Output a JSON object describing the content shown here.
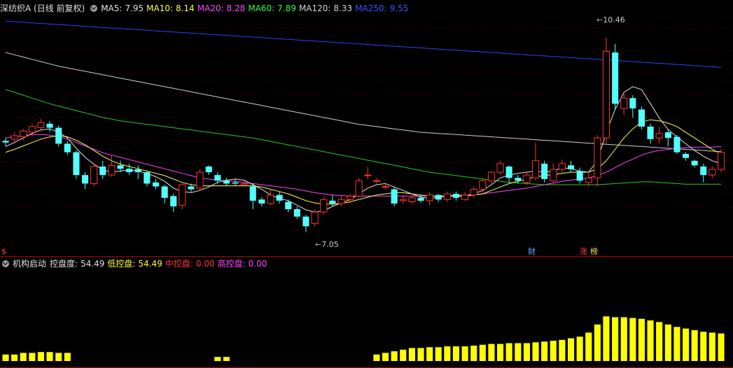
{
  "main": {
    "title": "深纺织A (日线 前复权)",
    "ma": [
      {
        "label": "MA5:",
        "value": "7.95",
        "color": "#e0e0e0"
      },
      {
        "label": "MA10:",
        "value": "8.14",
        "color": "#ffff55"
      },
      {
        "label": "MA20:",
        "value": "8.28",
        "color": "#ff44ff"
      },
      {
        "label": "MA60:",
        "value": "7.89",
        "color": "#33ff33"
      },
      {
        "label": "MA120:",
        "value": "8.33",
        "color": "#d0d0d0"
      },
      {
        "label": "MA250:",
        "value": "9.55",
        "color": "#3355ff"
      }
    ],
    "high_label": "10.46",
    "low_label": "7.05",
    "tags": {
      "left": "$",
      "cai": "财",
      "zhang": "涨",
      "bang": "榜"
    }
  },
  "sub": {
    "title": "机构启动",
    "items": [
      {
        "label": "控盘度:",
        "value": "54.49",
        "color": "#e0e0e0"
      },
      {
        "label": "低控盘:",
        "value": "54.49",
        "color": "#ffff33"
      },
      {
        "label": "中控盘:",
        "value": "0.00",
        "color": "#ff3333"
      },
      {
        "label": "高控盘:",
        "value": "0.00",
        "color": "#ff44ff"
      }
    ]
  },
  "chart_data": {
    "type": "candlestick",
    "y_range": [
      6.8,
      10.9
    ],
    "candles": [
      [
        8.65,
        8.62,
        8.7,
        8.55
      ],
      [
        8.68,
        8.74,
        8.8,
        8.62
      ],
      [
        8.72,
        8.82,
        8.86,
        8.66
      ],
      [
        8.8,
        8.9,
        8.94,
        8.74
      ],
      [
        8.88,
        8.97,
        9.03,
        8.82
      ],
      [
        8.95,
        8.88,
        9.0,
        8.8
      ],
      [
        8.88,
        8.6,
        8.92,
        8.55
      ],
      [
        8.6,
        8.45,
        8.65,
        8.4
      ],
      [
        8.45,
        8.05,
        8.48,
        7.98
      ],
      [
        8.05,
        7.9,
        8.1,
        7.8
      ],
      [
        7.9,
        8.2,
        8.25,
        7.85
      ],
      [
        8.2,
        8.05,
        8.3,
        7.98
      ],
      [
        8.05,
        8.22,
        8.4,
        8.02
      ],
      [
        8.22,
        8.16,
        8.3,
        8.1
      ],
      [
        8.16,
        8.1,
        8.25,
        8.05
      ],
      [
        8.15,
        8.1,
        8.22,
        7.98
      ],
      [
        8.1,
        7.9,
        8.12,
        7.85
      ],
      [
        7.92,
        7.85,
        7.98,
        7.8
      ],
      [
        7.85,
        7.65,
        7.88,
        7.55
      ],
      [
        7.68,
        7.5,
        7.72,
        7.4
      ],
      [
        7.52,
        7.88,
        7.92,
        7.45
      ],
      [
        7.85,
        7.8,
        7.9,
        7.75
      ],
      [
        7.82,
        8.1,
        8.15,
        7.78
      ],
      [
        8.2,
        8.1,
        8.22,
        8.05
      ],
      [
        8.05,
        7.95,
        8.1,
        7.9
      ],
      [
        7.95,
        7.9,
        8.0,
        7.86
      ],
      [
        7.92,
        7.9,
        7.98,
        7.86
      ],
      [
        7.88,
        7.9,
        7.95,
        7.84
      ],
      [
        7.85,
        7.6,
        7.9,
        7.45
      ],
      [
        7.62,
        7.55,
        7.66,
        7.5
      ],
      [
        7.55,
        7.7,
        7.8,
        7.52
      ],
      [
        7.7,
        7.6,
        7.75,
        7.55
      ],
      [
        7.58,
        7.45,
        7.62,
        7.4
      ],
      [
        7.45,
        7.32,
        7.5,
        7.28
      ],
      [
        7.32,
        7.15,
        7.35,
        7.05
      ],
      [
        7.2,
        7.4,
        7.45,
        7.15
      ],
      [
        7.4,
        7.62,
        7.66,
        7.35
      ],
      [
        7.6,
        7.55,
        7.7,
        7.5
      ],
      [
        7.55,
        7.62,
        7.7,
        7.5
      ],
      [
        7.62,
        7.68,
        7.72,
        7.55
      ],
      [
        7.68,
        7.95,
        8.0,
        7.65
      ],
      [
        8.05,
        8.05,
        8.2,
        7.98
      ],
      [
        7.95,
        7.95,
        8.0,
        7.9
      ],
      [
        7.85,
        7.85,
        7.9,
        7.8
      ],
      [
        7.8,
        7.55,
        7.85,
        7.5
      ],
      [
        7.6,
        7.62,
        7.7,
        7.55
      ],
      [
        7.58,
        7.65,
        7.72,
        7.55
      ],
      [
        7.65,
        7.6,
        7.7,
        7.56
      ],
      [
        7.6,
        7.7,
        7.75,
        7.52
      ],
      [
        7.7,
        7.62,
        7.72,
        7.58
      ],
      [
        7.62,
        7.72,
        7.76,
        7.58
      ],
      [
        7.72,
        7.65,
        7.76,
        7.6
      ],
      [
        7.62,
        7.7,
        7.75,
        7.6
      ],
      [
        7.7,
        7.8,
        7.85,
        7.65
      ],
      [
        7.8,
        7.95,
        8.0,
        7.75
      ],
      [
        7.95,
        8.1,
        8.12,
        7.9
      ],
      [
        8.1,
        8.25,
        8.3,
        8.05
      ],
      [
        8.2,
        8.0,
        8.22,
        7.92
      ],
      [
        8.0,
        7.95,
        8.05,
        7.9
      ],
      [
        7.92,
        8.05,
        8.1,
        7.88
      ],
      [
        8.0,
        8.3,
        8.62,
        7.95
      ],
      [
        8.25,
        7.98,
        8.3,
        7.92
      ],
      [
        7.95,
        8.15,
        8.25,
        7.92
      ],
      [
        8.15,
        8.25,
        8.32,
        8.1
      ],
      [
        8.22,
        8.15,
        8.3,
        8.1
      ],
      [
        8.12,
        7.95,
        8.18,
        7.9
      ],
      [
        7.92,
        8.0,
        8.1,
        7.85
      ],
      [
        8.0,
        8.7,
        8.75,
        7.85
      ],
      [
        8.7,
        10.22,
        10.46,
        8.6
      ],
      [
        10.2,
        9.3,
        10.35,
        9.2
      ],
      [
        9.22,
        9.4,
        9.5,
        9.1
      ],
      [
        9.4,
        9.22,
        9.45,
        9.05
      ],
      [
        9.2,
        8.9,
        9.25,
        8.85
      ],
      [
        8.9,
        8.68,
        8.95,
        8.6
      ],
      [
        8.7,
        8.78,
        8.9,
        8.6
      ],
      [
        8.8,
        8.7,
        8.85,
        8.55
      ],
      [
        8.72,
        8.45,
        8.75,
        8.42
      ],
      [
        8.42,
        8.35,
        8.45,
        8.3
      ],
      [
        8.3,
        8.22,
        8.32,
        8.18
      ],
      [
        8.2,
        8.05,
        8.25,
        7.92
      ],
      [
        8.05,
        8.15,
        8.2,
        8.0
      ],
      [
        8.15,
        8.45,
        8.5,
        8.1
      ]
    ],
    "ma5": [
      8.55,
      8.62,
      8.7,
      8.78,
      8.84,
      8.86,
      8.8,
      8.7,
      8.52,
      8.36,
      8.24,
      8.14,
      8.1,
      8.12,
      8.14,
      8.12,
      8.08,
      8.02,
      7.94,
      7.82,
      7.76,
      7.74,
      7.78,
      7.84,
      7.92,
      7.96,
      7.98,
      7.96,
      7.88,
      7.8,
      7.7,
      7.64,
      7.6,
      7.52,
      7.44,
      7.4,
      7.42,
      7.5,
      7.56,
      7.62,
      7.72,
      7.82,
      7.88,
      7.9,
      7.84,
      7.78,
      7.72,
      7.66,
      7.64,
      7.66,
      7.68,
      7.7,
      7.68,
      7.72,
      7.78,
      7.88,
      8.0,
      8.05,
      8.08,
      8.1,
      8.12,
      8.1,
      8.12,
      8.18,
      8.16,
      8.12,
      8.1,
      8.3,
      8.8,
      9.2,
      9.5,
      9.6,
      9.55,
      9.3,
      9.05,
      8.85,
      8.72,
      8.6,
      8.48,
      8.38,
      8.3,
      8.25
    ],
    "ma10": [
      8.45,
      8.5,
      8.56,
      8.62,
      8.68,
      8.72,
      8.74,
      8.72,
      8.66,
      8.58,
      8.48,
      8.38,
      8.3,
      8.24,
      8.2,
      8.16,
      8.12,
      8.08,
      8.04,
      7.98,
      7.92,
      7.88,
      7.86,
      7.86,
      7.86,
      7.86,
      7.86,
      7.86,
      7.86,
      7.84,
      7.8,
      7.76,
      7.72,
      7.66,
      7.6,
      7.56,
      7.54,
      7.54,
      7.55,
      7.58,
      7.62,
      7.66,
      7.7,
      7.72,
      7.74,
      7.74,
      7.72,
      7.7,
      7.68,
      7.68,
      7.68,
      7.68,
      7.68,
      7.7,
      7.72,
      7.78,
      7.84,
      7.9,
      7.94,
      7.98,
      8.02,
      8.04,
      8.06,
      8.08,
      8.1,
      8.1,
      8.1,
      8.16,
      8.3,
      8.5,
      8.7,
      8.86,
      8.98,
      9.02,
      9.0,
      8.96,
      8.9,
      8.8,
      8.7,
      8.6,
      8.5,
      8.42
    ],
    "ma20": [
      8.7,
      8.72,
      8.74,
      8.76,
      8.76,
      8.75,
      8.72,
      8.68,
      8.62,
      8.56,
      8.5,
      8.44,
      8.4,
      8.36,
      8.32,
      8.28,
      8.24,
      8.2,
      8.16,
      8.12,
      8.08,
      8.04,
      8.0,
      7.98,
      7.96,
      7.95,
      7.94,
      7.92,
      7.9,
      7.88,
      7.86,
      7.84,
      7.82,
      7.8,
      7.77,
      7.74,
      7.72,
      7.7,
      7.69,
      7.68,
      7.68,
      7.68,
      7.68,
      7.68,
      7.68,
      7.68,
      7.68,
      7.68,
      7.68,
      7.68,
      7.68,
      7.69,
      7.7,
      7.71,
      7.72,
      7.74,
      7.76,
      7.78,
      7.8,
      7.82,
      7.85,
      7.88,
      7.91,
      7.94,
      7.96,
      7.98,
      8.0,
      8.04,
      8.1,
      8.18,
      8.26,
      8.33,
      8.4,
      8.45,
      8.48,
      8.5,
      8.52,
      8.53,
      8.54,
      8.54,
      8.54,
      8.55
    ],
    "ma60": [
      9.55,
      9.5,
      9.45,
      9.4,
      9.35,
      9.3,
      9.26,
      9.22,
      9.18,
      9.14,
      9.1,
      9.06,
      9.03,
      9.0,
      8.98,
      8.96,
      8.94,
      8.92,
      8.9,
      8.88,
      8.86,
      8.84,
      8.82,
      8.8,
      8.78,
      8.76,
      8.74,
      8.72,
      8.7,
      8.67,
      8.64,
      8.61,
      8.58,
      8.55,
      8.52,
      8.49,
      8.46,
      8.43,
      8.4,
      8.37,
      8.34,
      8.31,
      8.28,
      8.25,
      8.22,
      8.19,
      8.16,
      8.13,
      8.1,
      8.08,
      8.06,
      8.04,
      8.02,
      8.0,
      7.98,
      7.96,
      7.94,
      7.92,
      7.91,
      7.9,
      7.89,
      7.88,
      7.88,
      7.88,
      7.88,
      7.88,
      7.88,
      7.88,
      7.89,
      7.9,
      7.91,
      7.92,
      7.93,
      7.93,
      7.92,
      7.91,
      7.9,
      7.89,
      7.89,
      7.89,
      7.89,
      7.89
    ],
    "ma120": [
      10.2,
      10.16,
      10.12,
      10.08,
      10.04,
      10.0,
      9.96,
      9.93,
      9.9,
      9.87,
      9.84,
      9.81,
      9.78,
      9.75,
      9.72,
      9.69,
      9.66,
      9.63,
      9.6,
      9.57,
      9.54,
      9.51,
      9.48,
      9.45,
      9.42,
      9.39,
      9.36,
      9.33,
      9.3,
      9.27,
      9.24,
      9.21,
      9.18,
      9.15,
      9.12,
      9.09,
      9.06,
      9.03,
      9.0,
      8.97,
      8.94,
      8.92,
      8.9,
      8.88,
      8.86,
      8.84,
      8.82,
      8.8,
      8.79,
      8.78,
      8.77,
      8.76,
      8.75,
      8.74,
      8.73,
      8.72,
      8.71,
      8.7,
      8.69,
      8.68,
      8.67,
      8.66,
      8.65,
      8.64,
      8.63,
      8.62,
      8.61,
      8.6,
      8.59,
      8.58,
      8.57,
      8.56,
      8.55,
      8.54,
      8.53,
      8.52,
      8.51,
      8.5,
      8.49,
      8.48,
      8.47,
      8.46
    ],
    "ma250": [
      10.75,
      10.74,
      10.73,
      10.72,
      10.71,
      10.7,
      10.69,
      10.68,
      10.67,
      10.66,
      10.65,
      10.64,
      10.63,
      10.62,
      10.61,
      10.6,
      10.59,
      10.58,
      10.57,
      10.56,
      10.55,
      10.54,
      10.53,
      10.52,
      10.51,
      10.5,
      10.49,
      10.48,
      10.47,
      10.46,
      10.45,
      10.44,
      10.43,
      10.42,
      10.41,
      10.4,
      10.39,
      10.38,
      10.37,
      10.36,
      10.35,
      10.34,
      10.33,
      10.32,
      10.31,
      10.3,
      10.29,
      10.28,
      10.27,
      10.26,
      10.25,
      10.24,
      10.23,
      10.22,
      10.21,
      10.2,
      10.19,
      10.18,
      10.17,
      10.16,
      10.15,
      10.14,
      10.13,
      10.12,
      10.11,
      10.1,
      10.09,
      10.08,
      10.07,
      10.06,
      10.05,
      10.04,
      10.03,
      10.02,
      10.01,
      10.0,
      9.99,
      9.98,
      9.97,
      9.96,
      9.95,
      9.94
    ],
    "sub_bars": {
      "range": [
        0,
        100
      ],
      "values": [
        8,
        8,
        10,
        10,
        11,
        11,
        10,
        10,
        0,
        0,
        0,
        0,
        0,
        0,
        0,
        0,
        0,
        0,
        0,
        0,
        0,
        0,
        0,
        0,
        5,
        5,
        0,
        0,
        0,
        0,
        0,
        0,
        0,
        0,
        0,
        0,
        0,
        0,
        0,
        0,
        0,
        0,
        8,
        10,
        12,
        14,
        16,
        16,
        17,
        17,
        18,
        18,
        18,
        19,
        20,
        21,
        21,
        22,
        22,
        22,
        23,
        24,
        25,
        26,
        28,
        30,
        35,
        45,
        55,
        54,
        54,
        53,
        52,
        50,
        48,
        45,
        42,
        40,
        38,
        36,
        35,
        34
      ]
    }
  }
}
